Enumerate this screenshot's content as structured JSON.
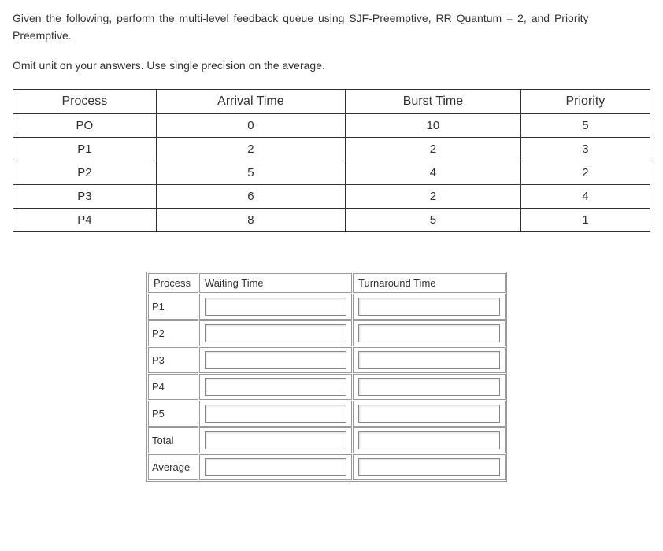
{
  "problem": {
    "line1": "Given the following, perform the multi-level feedback queue using SJF-Preemptive, RR Quantum = 2, and Priority Preemptive.",
    "line2": "Omit unit on your answers. Use single precision on the average."
  },
  "data_table": {
    "headers": [
      "Process",
      "Arrival Time",
      "Burst Time",
      "Priority"
    ],
    "rows": [
      {
        "process": "PO",
        "arrival": "0",
        "burst": "10",
        "priority": "5"
      },
      {
        "process": "P1",
        "arrival": "2",
        "burst": "2",
        "priority": "3"
      },
      {
        "process": "P2",
        "arrival": "5",
        "burst": "4",
        "priority": "2"
      },
      {
        "process": "P3",
        "arrival": "6",
        "burst": "2",
        "priority": "4"
      },
      {
        "process": "P4",
        "arrival": "8",
        "burst": "5",
        "priority": "1"
      }
    ]
  },
  "answer_table": {
    "headers": [
      "Process",
      "Waiting Time",
      "Turnaround Time"
    ],
    "row_labels": [
      "P1",
      "P2",
      "P3",
      "P4",
      "P5",
      "Total",
      "Average"
    ],
    "values": {
      "P1": {
        "waiting": "",
        "turnaround": ""
      },
      "P2": {
        "waiting": "",
        "turnaround": ""
      },
      "P3": {
        "waiting": "",
        "turnaround": ""
      },
      "P4": {
        "waiting": "",
        "turnaround": ""
      },
      "P5": {
        "waiting": "",
        "turnaround": ""
      },
      "Total": {
        "waiting": "",
        "turnaround": ""
      },
      "Average": {
        "waiting": "",
        "turnaround": ""
      }
    }
  }
}
